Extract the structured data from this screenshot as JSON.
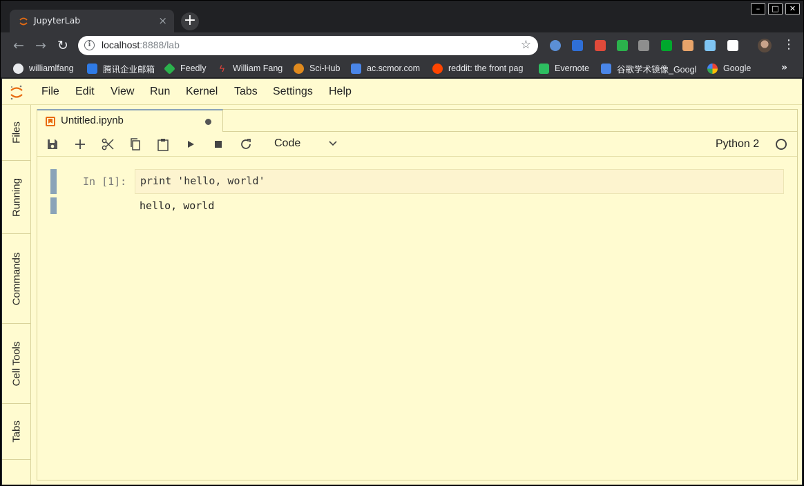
{
  "browser": {
    "tab_title": "JupyterLab",
    "tab_close": "×",
    "new_tab": "+",
    "url_host": "localhost",
    "url_rest": ":8888/lab",
    "window_controls": [
      "–",
      "□",
      "✕"
    ]
  },
  "extensions": [
    {
      "name": "ext-blue-circle",
      "color": "#5b8fd6"
    },
    {
      "name": "ext-blue-book",
      "color": "#2f6fd6"
    },
    {
      "name": "ext-chrome-multicolor",
      "color": "#e04a3a"
    },
    {
      "name": "ext-green-feedly",
      "color": "#2bb24c"
    },
    {
      "name": "ext-ghost",
      "color": "#8e8e8e"
    },
    {
      "name": "ext-evernote",
      "color": "#00a82d"
    },
    {
      "name": "ext-orange-face",
      "color": "#e8a46a"
    },
    {
      "name": "ext-diamond",
      "color": "#7fc4f2"
    },
    {
      "name": "ext-wikipedia",
      "color": "#ffffff"
    }
  ],
  "bookmarks": [
    {
      "label": "williamlfang",
      "icon": "github-icon",
      "color": "#2b2b2b"
    },
    {
      "label": "腾讯企业邮箱",
      "icon": "tencent-mail-icon",
      "color": "#2f7be6"
    },
    {
      "label": "Feedly",
      "icon": "feedly-icon",
      "color": "#2bb24c"
    },
    {
      "label": "William Fang",
      "icon": "bolt-icon",
      "color": "#d33a2f"
    },
    {
      "label": "Sci-Hub",
      "icon": "scihub-icon",
      "color": "#e08a1e"
    },
    {
      "label": "ac.scmor.com",
      "icon": "scholar-icon",
      "color": "#4a86e8"
    },
    {
      "label": "reddit: the front pag",
      "icon": "reddit-icon",
      "color": "#ff4500"
    },
    {
      "label": "Evernote",
      "icon": "evernote-icon",
      "color": "#2dbe60"
    },
    {
      "label": "谷歌学术镜像_Googl",
      "icon": "scholar-icon",
      "color": "#4a86e8"
    },
    {
      "label": "Google",
      "icon": "google-icon",
      "color": "#ffffff"
    }
  ],
  "bookmarks_more": "»",
  "menu": [
    "File",
    "Edit",
    "View",
    "Run",
    "Kernel",
    "Tabs",
    "Settings",
    "Help"
  ],
  "sidebar": [
    "Files",
    "Running",
    "Commands",
    "Cell Tools",
    "Tabs"
  ],
  "notebook": {
    "tab_name": "Untitled.ipynb",
    "cell_type": "Code",
    "kernel": "Python 2",
    "cell_prompt": "In [1]:",
    "cell_code": "print 'hello, world'",
    "cell_output": "hello, world"
  },
  "colors": {
    "jupyter_bg": "#fffbd0",
    "cell_bar": "#8aa3b8",
    "jupyter_orange": "#e86c12"
  }
}
